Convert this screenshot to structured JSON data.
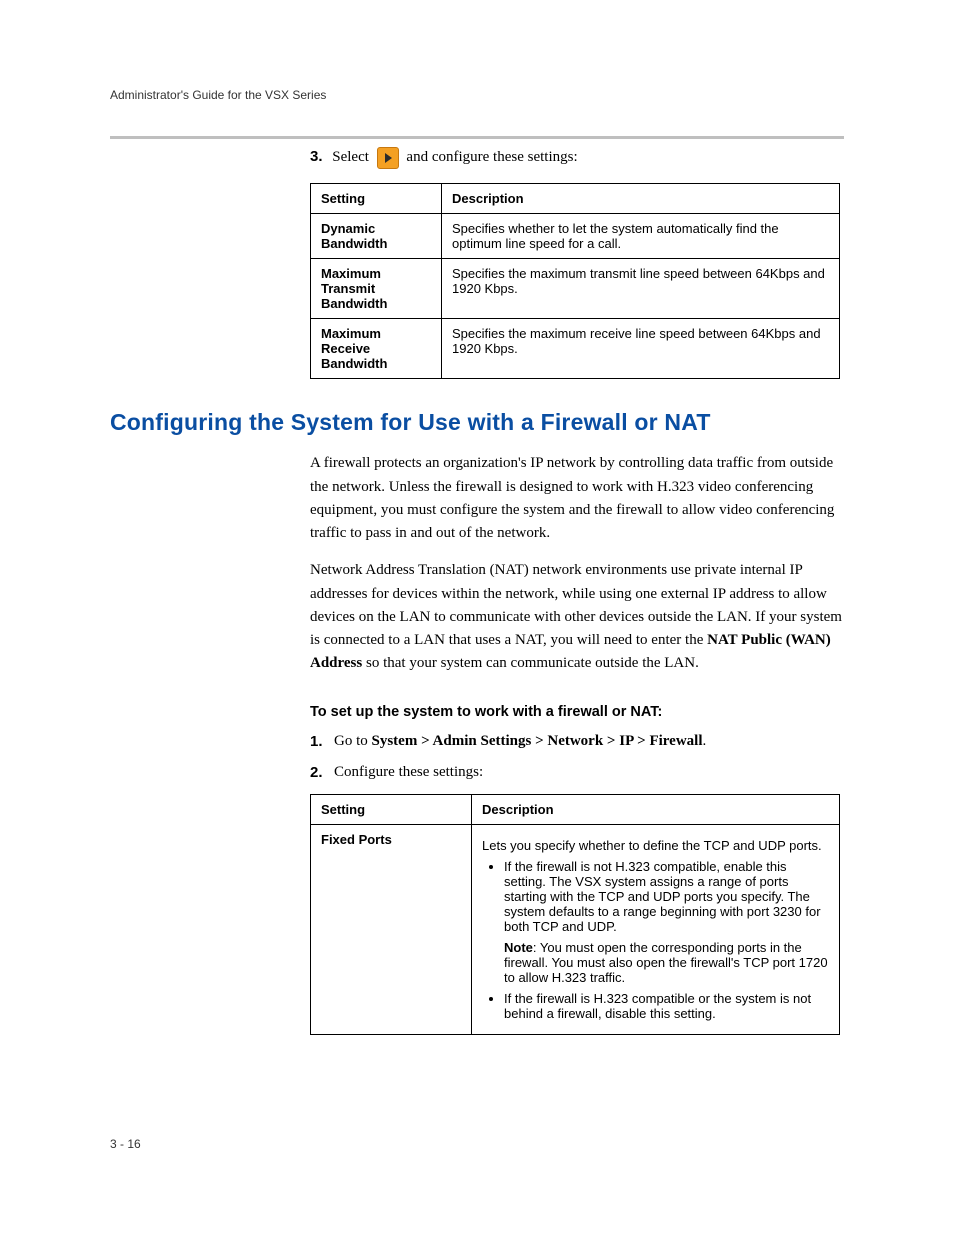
{
  "header": {
    "runningTitle": "Administrator's Guide for the VSX Series"
  },
  "step3": {
    "num": "3.",
    "before": "Select",
    "after": "and configure these settings:"
  },
  "table1": {
    "headers": {
      "setting": "Setting",
      "description": "Description"
    },
    "rows": [
      {
        "setting": "Dynamic Bandwidth",
        "description": "Specifies whether to let the system automatically find the optimum line speed for a call."
      },
      {
        "setting": "Maximum Transmit Bandwidth",
        "description": "Specifies the maximum transmit line speed between 64Kbps and 1920 Kbps."
      },
      {
        "setting": "Maximum Receive Bandwidth",
        "description": "Specifies the maximum receive line speed between 64Kbps and 1920 Kbps."
      }
    ]
  },
  "section": {
    "title": "Configuring the System for Use with a Firewall or NAT",
    "para1": "A firewall protects an organization's IP network by controlling data traffic from outside the network. Unless the firewall is designed to work with H.323 video conferencing equipment, you must configure the system and the firewall to allow video conferencing traffic to pass in and out of the network.",
    "para2_before": "Network Address Translation (NAT) network environments use private internal IP addresses for devices within the network, while using one external IP address to allow devices on the LAN to communicate with other devices outside the LAN. If your system is connected to a LAN that uses a NAT, you will need to enter the ",
    "para2_bold": "NAT Public (WAN) Address",
    "para2_after": " so that your system can communicate outside the LAN."
  },
  "procedure": {
    "title": "To set up the system to work with a firewall or NAT:",
    "steps": [
      {
        "num": "1.",
        "before": "Go to ",
        "bold": "System > Admin Settings > Network > IP > Firewall",
        "after": "."
      },
      {
        "num": "2.",
        "before": "Configure these settings:",
        "bold": "",
        "after": ""
      }
    ]
  },
  "table2": {
    "headers": {
      "setting": "Setting",
      "description": "Description"
    },
    "row": {
      "setting": "Fixed Ports",
      "intro": "Lets you specify whether to define the TCP and UDP ports.",
      "bullet1": "If the firewall is not H.323 compatible, enable this setting. The VSX system assigns a range of ports starting with the TCP and UDP ports you specify. The system defaults to a range beginning with port 3230 for both TCP and UDP.",
      "noteLabel": "Note",
      "noteText": ": You must open the corresponding ports in the firewall. You must also open the firewall's TCP port 1720 to allow H.323 traffic.",
      "bullet2": "If the firewall is H.323 compatible or the system is not behind a firewall, disable this setting."
    }
  },
  "footer": {
    "pageNumber": "3 - 16"
  }
}
